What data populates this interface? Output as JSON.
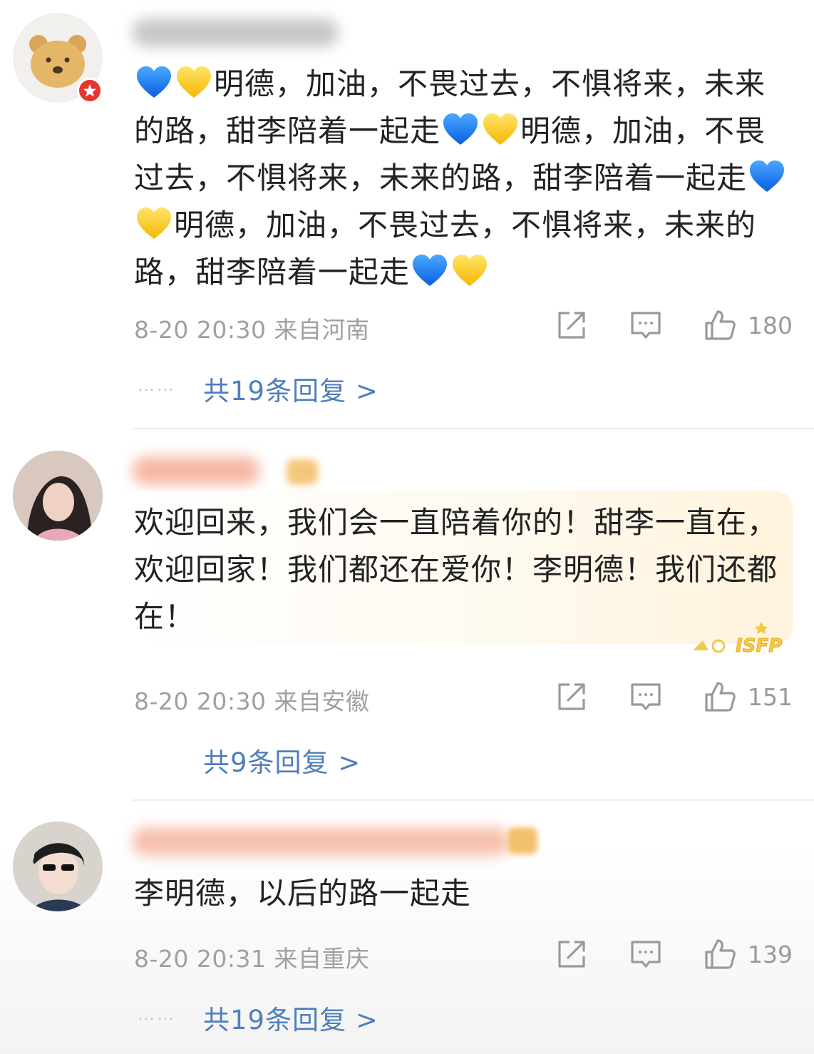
{
  "comments": [
    {
      "text": "明德，加油，不畏过去，不惧将来，未来的路，甜李陪着一起走",
      "meta": "8-20 20:30 来自河南",
      "likes": "180",
      "replies": "共19条回复 >",
      "dots": "……"
    },
    {
      "text": "欢迎回来，我们会一直陪着你的！甜李一直在，欢迎回家！我们都还在爱你！李明德！我们还都在！",
      "meta": "8-20 20:30 来自安徽",
      "likes": "151",
      "replies": "共9条回复 >",
      "badge": "ISFP"
    },
    {
      "text": "李明德，以后的路一起走",
      "meta": "8-20 20:31 来自重庆",
      "likes": "139",
      "replies": "共19条回复 >",
      "dots": "……"
    }
  ],
  "colors": {
    "text": "#222222",
    "meta": "#a0a0a0",
    "reply_link": "#4e7fba",
    "blue_heart": "#1677ff",
    "yellow_heart": "#ffcc1f"
  },
  "icons": [
    "share-icon",
    "comment-icon",
    "like-icon",
    "blue-heart-icon",
    "yellow-heart-icon",
    "verified-badge-icon"
  ]
}
